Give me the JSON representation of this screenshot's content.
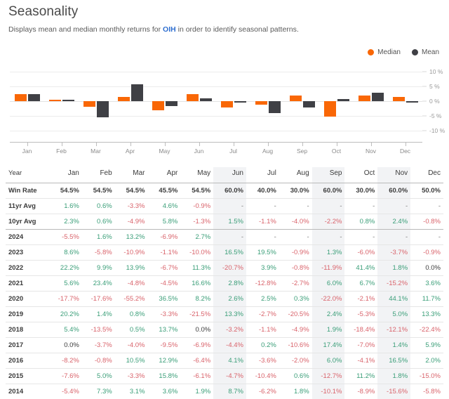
{
  "header": {
    "title": "Seasonality",
    "subtitle_pre": "Displays mean and median monthly returns for ",
    "ticker": "OIH",
    "subtitle_post": " in order to identify seasonal patterns.",
    "ticker_color": "#2f6fd0"
  },
  "legend": {
    "items": [
      {
        "label": "Median",
        "color": "#f96706",
        "icon": "circle-dot-icon"
      },
      {
        "label": "Mean",
        "color": "#3f4045",
        "icon": "circle-dot-icon"
      }
    ]
  },
  "chart_data": {
    "type": "bar",
    "title": "Seasonality",
    "xlabel": "",
    "ylabel": "",
    "ylim": [
      -12.5,
      12.5
    ],
    "yticks": [
      10,
      5,
      0,
      -5,
      -10
    ],
    "ytick_labels": [
      "10 %",
      "5 %",
      "0 %",
      "-5 %",
      "-10 %"
    ],
    "grid": true,
    "legend_position": "top-right",
    "categories": [
      "Jan",
      "Feb",
      "Mar",
      "Apr",
      "May",
      "Jun",
      "Jul",
      "Aug",
      "Sep",
      "Oct",
      "Nov",
      "Dec"
    ],
    "series": [
      {
        "name": "Median",
        "color": "#f96706",
        "values": [
          2.3,
          0.6,
          -1.9,
          1.5,
          -3.2,
          2.4,
          -2.2,
          -1.1,
          1.9,
          -5.3,
          2.0,
          1.4
        ]
      },
      {
        "name": "Mean",
        "color": "#3f4045",
        "values": [
          2.3,
          0.4,
          -5.5,
          5.8,
          -1.7,
          0.9,
          -0.6,
          -4.0,
          -2.2,
          0.8,
          2.9,
          -0.5
        ]
      }
    ]
  },
  "table": {
    "columns": [
      "Year",
      "Jan",
      "Feb",
      "Mar",
      "Apr",
      "May",
      "Jun",
      "Jul",
      "Aug",
      "Sep",
      "Oct",
      "Nov",
      "Dec"
    ],
    "shaded_columns": [
      "Jun",
      "Sep",
      "Nov"
    ],
    "rows": [
      {
        "label": "Win Rate",
        "kind": "winrate",
        "values": [
          "54.5%",
          "54.5%",
          "54.5%",
          "45.5%",
          "54.5%",
          "60.0%",
          "40.0%",
          "30.0%",
          "60.0%",
          "30.0%",
          "60.0%",
          "50.0%"
        ]
      },
      {
        "label": "11yr Avg",
        "kind": "avg",
        "values": [
          "1.6%",
          "0.6%",
          "-3.3%",
          "4.6%",
          "-0.9%",
          "-",
          "-",
          "-",
          "-",
          "-",
          "-",
          "-"
        ]
      },
      {
        "label": "10yr Avg",
        "kind": "avg",
        "values": [
          "2.3%",
          "0.6%",
          "-4.9%",
          "5.8%",
          "-1.3%",
          "1.5%",
          "-1.1%",
          "-4.0%",
          "-2.2%",
          "0.8%",
          "2.4%",
          "-0.8%"
        ]
      },
      {
        "label": "2024",
        "kind": "year",
        "values": [
          "-5.5%",
          "1.6%",
          "13.2%",
          "-6.9%",
          "2.7%",
          "-",
          "-",
          "-",
          "-",
          "-",
          "-",
          "-"
        ]
      },
      {
        "label": "2023",
        "kind": "year",
        "values": [
          "8.6%",
          "-5.8%",
          "-10.9%",
          "-1.1%",
          "-10.0%",
          "16.5%",
          "19.5%",
          "-0.9%",
          "1.3%",
          "-6.0%",
          "-3.7%",
          "-0.9%"
        ]
      },
      {
        "label": "2022",
        "kind": "year",
        "values": [
          "22.2%",
          "9.9%",
          "13.9%",
          "-6.7%",
          "11.3%",
          "-20.7%",
          "3.9%",
          "-0.8%",
          "-11.9%",
          "41.4%",
          "1.8%",
          "0.0%"
        ]
      },
      {
        "label": "2021",
        "kind": "year",
        "values": [
          "5.6%",
          "23.4%",
          "-4.8%",
          "-4.5%",
          "16.6%",
          "2.8%",
          "-12.8%",
          "-2.7%",
          "6.0%",
          "6.7%",
          "-15.2%",
          "3.6%"
        ]
      },
      {
        "label": "2020",
        "kind": "year",
        "values": [
          "-17.7%",
          "-17.6%",
          "-55.2%",
          "36.5%",
          "8.2%",
          "2.6%",
          "2.5%",
          "0.3%",
          "-22.0%",
          "-2.1%",
          "44.1%",
          "11.7%"
        ]
      },
      {
        "label": "2019",
        "kind": "year",
        "values": [
          "20.2%",
          "1.4%",
          "0.8%",
          "-3.3%",
          "-21.5%",
          "13.3%",
          "-2.7%",
          "-20.5%",
          "2.4%",
          "-5.3%",
          "5.0%",
          "13.3%"
        ]
      },
      {
        "label": "2018",
        "kind": "year",
        "values": [
          "5.4%",
          "-13.5%",
          "0.5%",
          "13.7%",
          "0.0%",
          "-3.2%",
          "-1.1%",
          "-4.9%",
          "1.9%",
          "-18.4%",
          "-12.1%",
          "-22.4%"
        ]
      },
      {
        "label": "2017",
        "kind": "year",
        "values": [
          "0.0%",
          "-3.7%",
          "-4.0%",
          "-9.5%",
          "-6.9%",
          "-4.4%",
          "0.2%",
          "-10.6%",
          "17.4%",
          "-7.0%",
          "1.4%",
          "5.9%"
        ]
      },
      {
        "label": "2016",
        "kind": "year",
        "values": [
          "-8.2%",
          "-0.8%",
          "10.5%",
          "12.9%",
          "-6.4%",
          "4.1%",
          "-3.6%",
          "-2.0%",
          "6.0%",
          "-4.1%",
          "16.5%",
          "2.0%"
        ]
      },
      {
        "label": "2015",
        "kind": "year",
        "values": [
          "-7.6%",
          "5.0%",
          "-3.3%",
          "15.8%",
          "-6.1%",
          "-4.7%",
          "-10.4%",
          "0.6%",
          "-12.7%",
          "11.2%",
          "1.8%",
          "-15.0%"
        ]
      },
      {
        "label": "2014",
        "kind": "year",
        "values": [
          "-5.4%",
          "7.3%",
          "3.1%",
          "3.6%",
          "1.9%",
          "8.7%",
          "-6.2%",
          "1.8%",
          "-10.1%",
          "-8.9%",
          "-15.6%",
          "-5.8%"
        ]
      }
    ]
  }
}
